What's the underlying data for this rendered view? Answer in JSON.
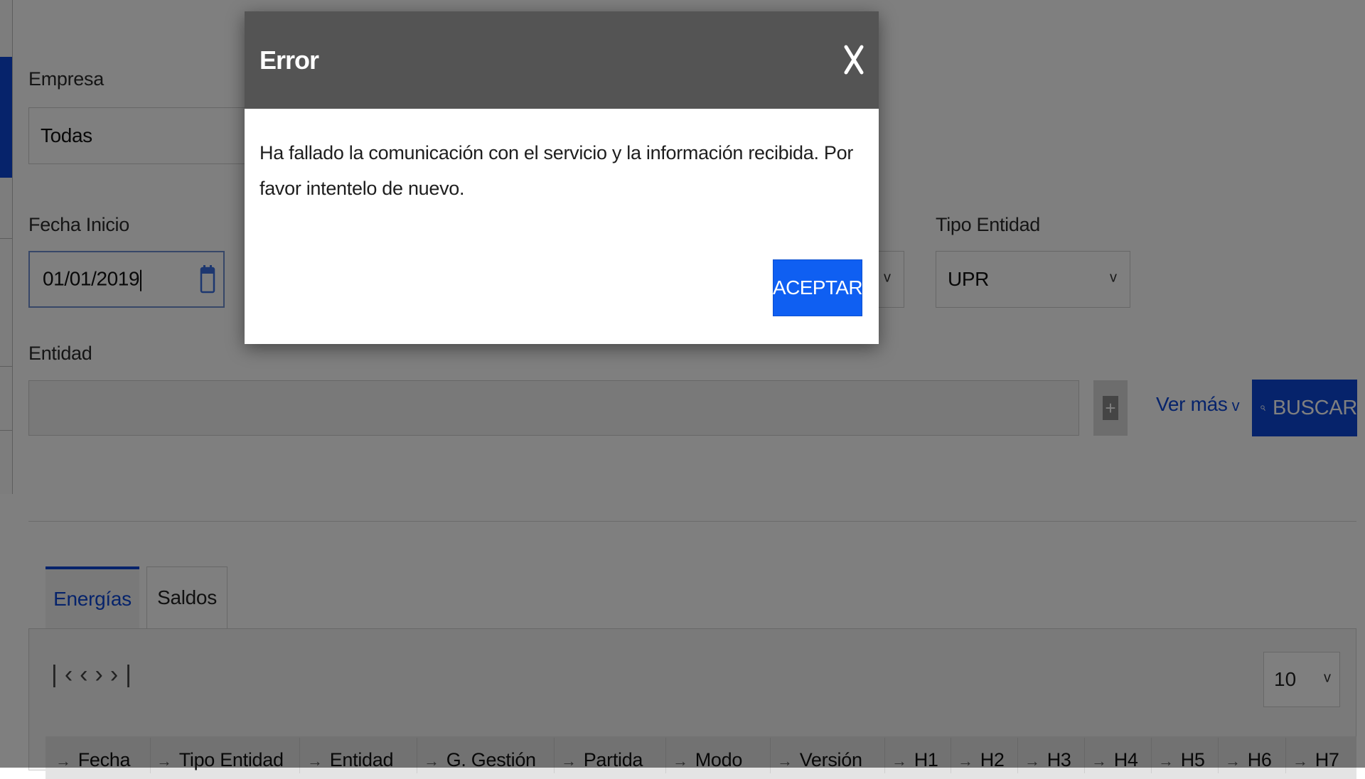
{
  "filters": {
    "empresa_label": "Empresa",
    "empresa_value": "Todas",
    "fecha_inicio_label": "Fecha Inicio",
    "fecha_inicio_value": "01/01/2019",
    "tipo_entidad_label": "Tipo Entidad",
    "tipo_entidad_value": "UPR",
    "entidad_label": "Entidad",
    "entidad_value": "",
    "ver_mas_label": "Ver más",
    "buscar_label": "BUSCAR",
    "add_symbol": "+"
  },
  "tabs": [
    {
      "label": "Energías",
      "active": true
    },
    {
      "label": "Saldos",
      "active": false
    }
  ],
  "pager": {
    "controls": "|‹ ‹ › ›|",
    "page_size": "10"
  },
  "table": {
    "headers": [
      "Fecha",
      "Tipo Entidad",
      "Entidad",
      "G. Gestión",
      "Partida",
      "Modo",
      "Versión",
      "H1",
      "H2",
      "H3",
      "H4",
      "H5",
      "H6",
      "H7"
    ]
  },
  "modal": {
    "title": "Error",
    "close_symbol": "X",
    "message": "Ha fallado la comunicación con el servicio y la información recibida. Por favor intentelo de nuevo.",
    "accept_label": "ACEPTAR"
  },
  "colors": {
    "accent": "#0d47d6",
    "modal_header": "#545454",
    "accept_button": "#0f5ff2"
  },
  "icons": [
    "calendar-icon",
    "chevron-down-icon",
    "plus-icon",
    "search-icon",
    "close-icon",
    "sort-arrow-icon",
    "pager-first-icon",
    "pager-prev-icon",
    "pager-next-icon",
    "pager-last-icon"
  ]
}
